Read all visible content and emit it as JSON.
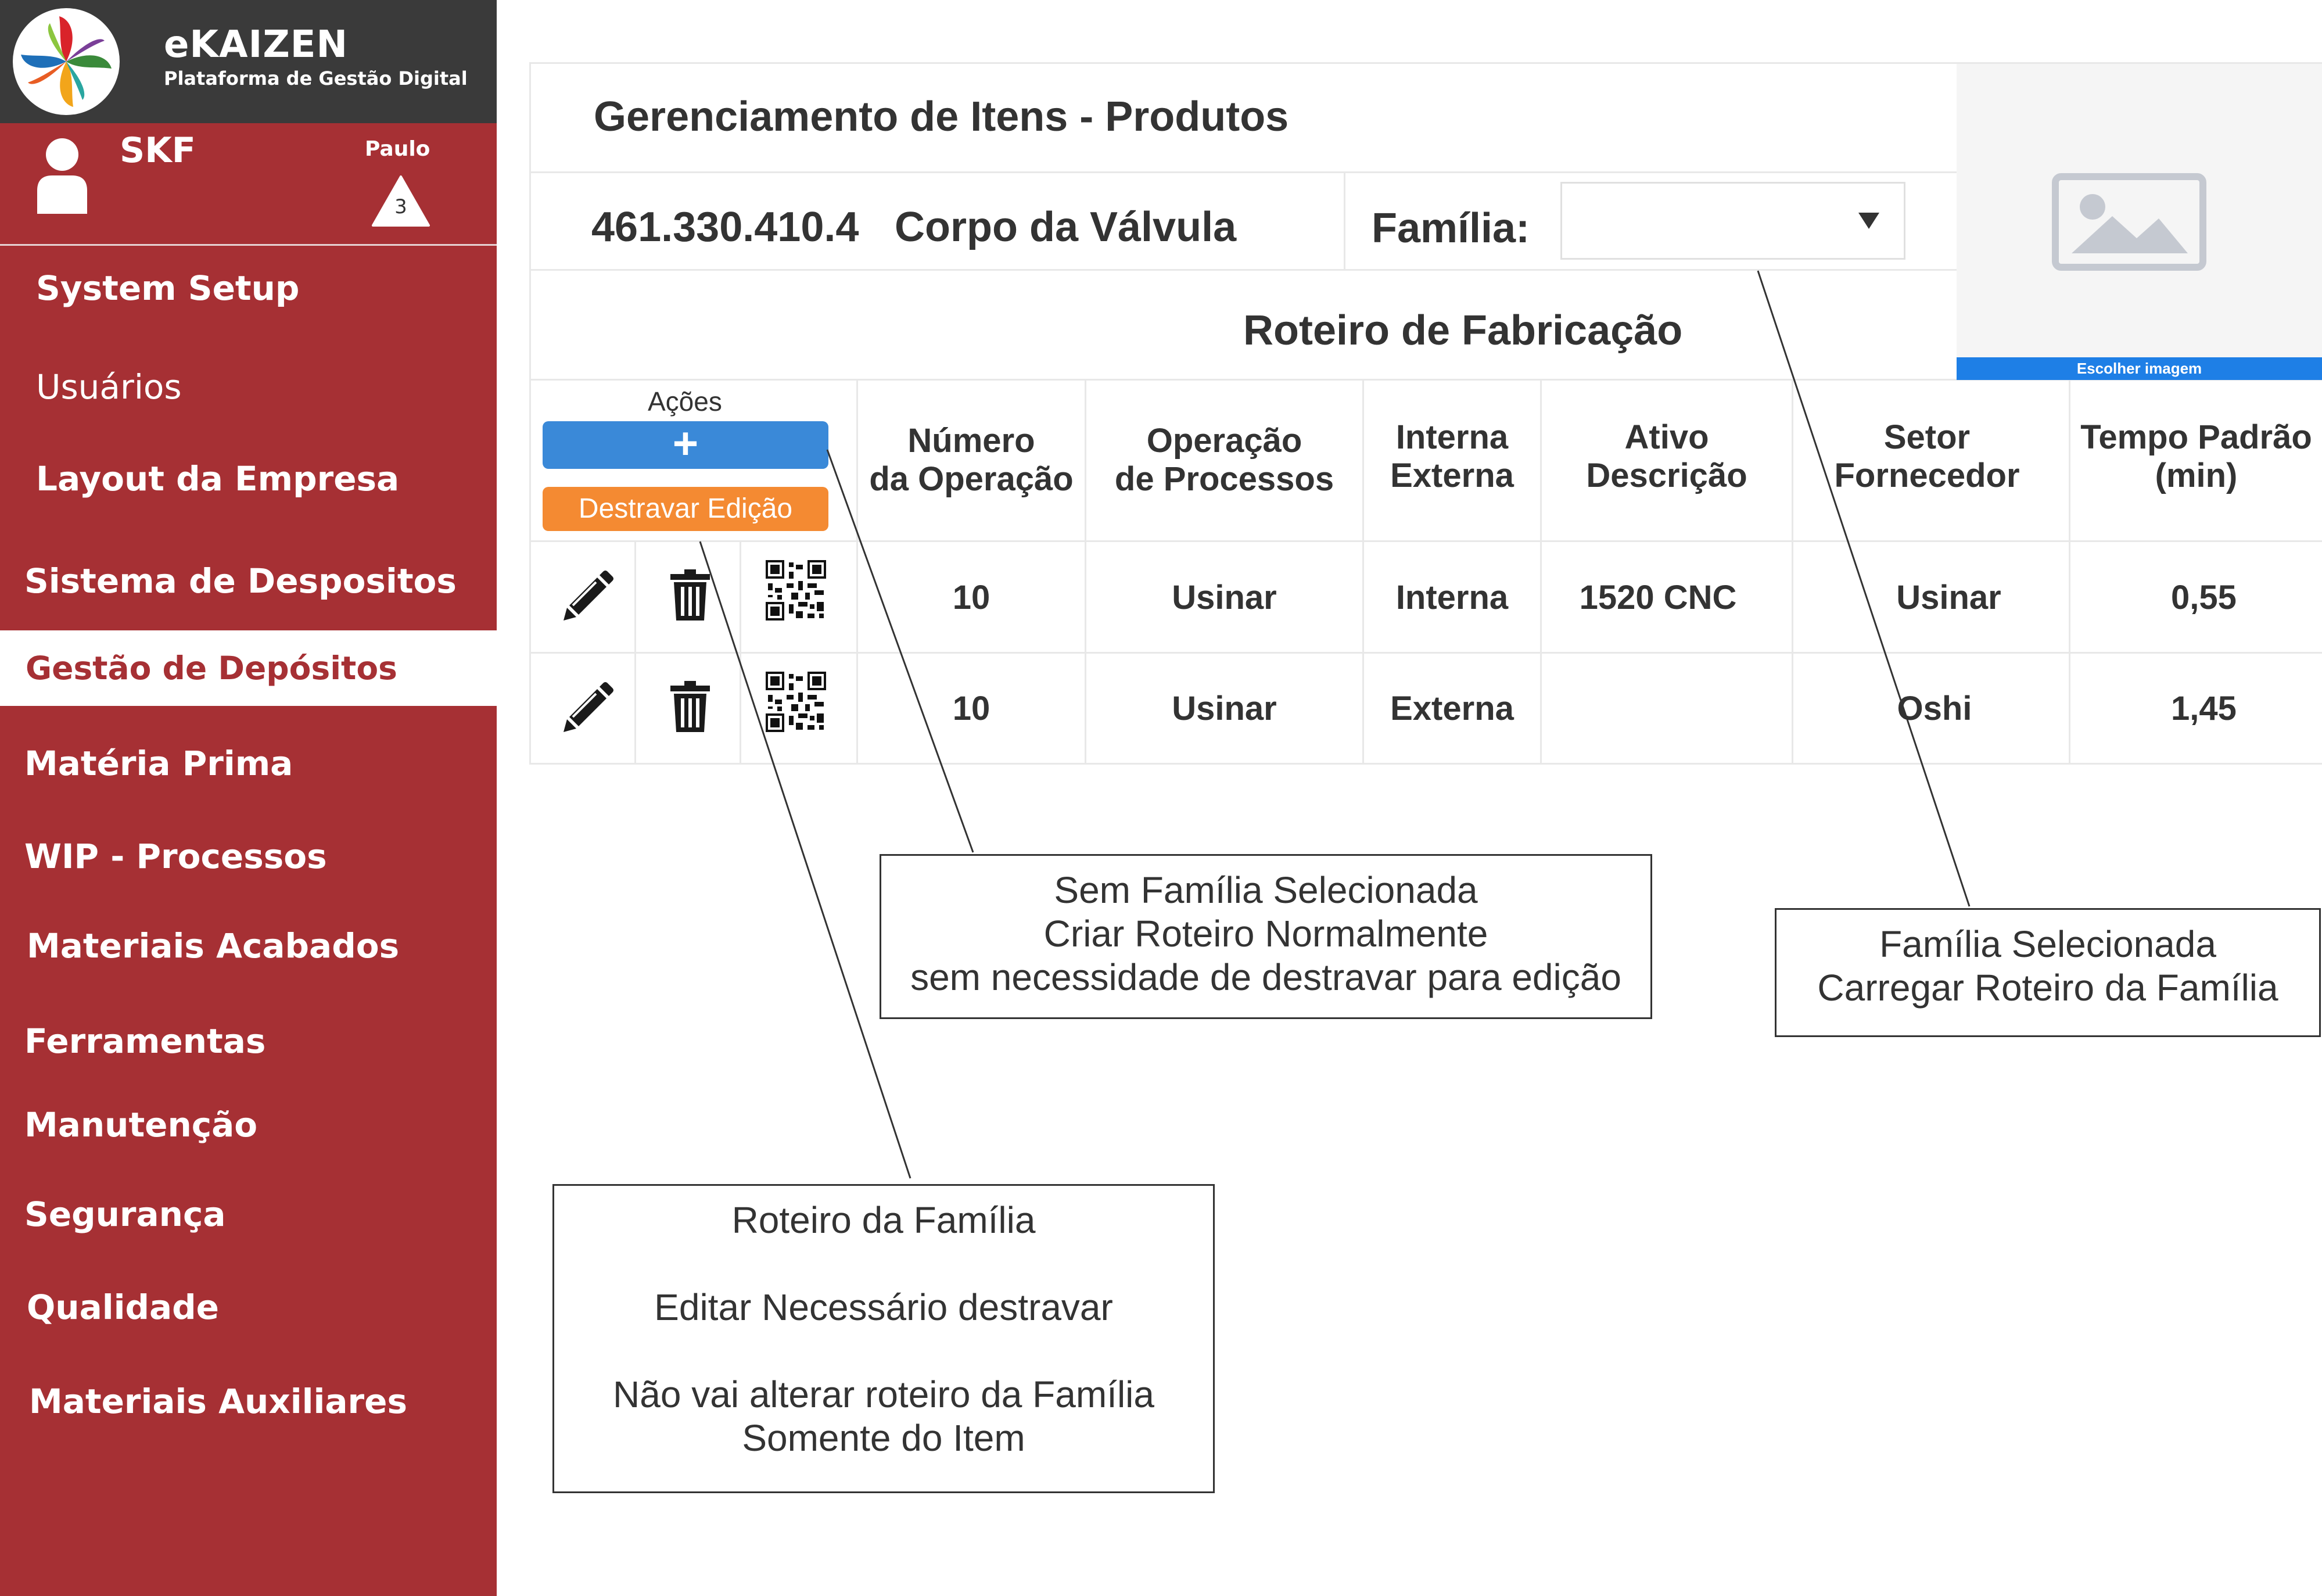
{
  "brand": {
    "name": "eKAIZEN",
    "subtitle": "Plataforma de Gestão Digital"
  },
  "user": {
    "company": "SKF",
    "name": "Paulo",
    "alert_count": "3",
    "avatar_icon": "user-icon",
    "alert_icon": "warning-triangle-icon"
  },
  "sidebar": {
    "items": [
      {
        "label": "System Setup"
      },
      {
        "label": "Usuários"
      },
      {
        "label": "Layout da Empresa"
      },
      {
        "label": "Sistema de Despositos"
      },
      {
        "label": "Gestão de Depósitos",
        "active": true
      },
      {
        "label": "Matéria Prima"
      },
      {
        "label": "WIP - Processos"
      },
      {
        "label": "Materiais Acabados"
      },
      {
        "label": "Ferramentas"
      },
      {
        "label": "Manutenção"
      },
      {
        "label": "Segurança"
      },
      {
        "label": "Qualidade"
      },
      {
        "label": "Materiais Auxiliares"
      }
    ]
  },
  "page": {
    "title": "Gerenciamento de Itens - Produtos",
    "item_code": "461.330.410.4",
    "item_name": "Corpo da Válvula",
    "familia_label": "Família:",
    "familia_value": "",
    "image_button": "Escolher imagem",
    "image_placeholder_icon": "image-placeholder-icon",
    "section_title": "Roteiro de Fabricação"
  },
  "table": {
    "actions_label": "Ações",
    "add_button": "+",
    "unlock_button": "Destravar Edição",
    "row_icons": [
      "pencil-icon",
      "trash-icon",
      "qr-code-icon"
    ],
    "headers": [
      [
        "Número",
        "da Operação"
      ],
      [
        "Operação",
        "de Processos"
      ],
      [
        "Interna",
        "Externa"
      ],
      [
        "Ativo",
        "Descrição"
      ],
      [
        "Setor",
        "Fornecedor"
      ],
      [
        "Tempo Padrão",
        "(min)"
      ]
    ],
    "rows": [
      [
        "10",
        "Usinar",
        "Interna",
        "1520 CNC",
        "Usinar",
        "0,55"
      ],
      [
        "10",
        "Usinar",
        "Externa",
        "",
        "Oshi",
        "1,45"
      ]
    ]
  },
  "callouts": {
    "no_family": [
      "Sem Família Selecionada",
      "Criar Roteiro Normalmente",
      "sem necessidade de destravar para edição"
    ],
    "family_selected": [
      "Família Selecionada",
      "Carregar Roteiro da Família"
    ],
    "family_routing": [
      "Roteiro da Família",
      "Editar Necessário destravar",
      "Não vai alterar roteiro da Família",
      "Somente do Item"
    ]
  },
  "colors": {
    "sidebar": "#a63034",
    "header": "#3a3a3a",
    "add_button": "#3a89d8",
    "unlock_button": "#f48a32",
    "image_button": "#1e7fe6"
  }
}
